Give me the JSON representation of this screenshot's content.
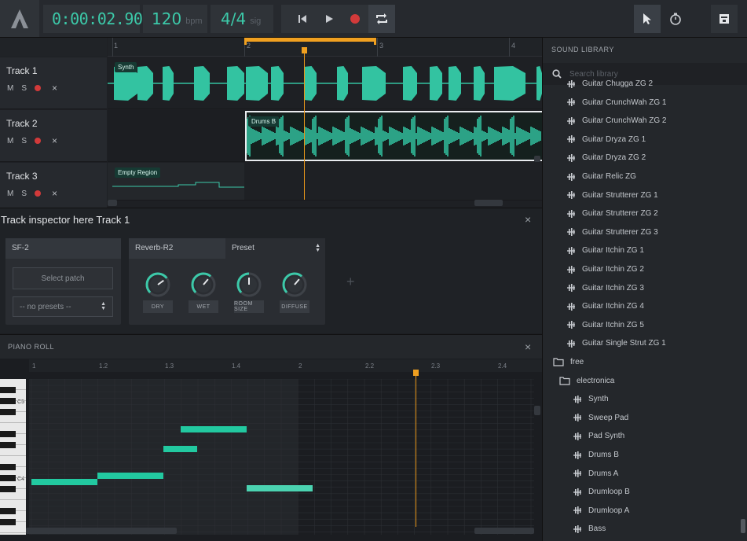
{
  "toolbar": {
    "time": "0:00:02.90",
    "bpm_value": "120",
    "bpm_unit": "bpm",
    "sig_value": "4/4",
    "sig_unit": "sig"
  },
  "arrangement": {
    "ruler_ticks": [
      "1",
      "2",
      "3",
      "4"
    ],
    "tracks": [
      {
        "name": "Track 1",
        "mute": "M",
        "solo": "S",
        "delete": "×",
        "region": "Synth"
      },
      {
        "name": "Track 2",
        "mute": "M",
        "solo": "S",
        "delete": "×",
        "region": "Drums B"
      },
      {
        "name": "Track 3",
        "mute": "M",
        "solo": "S",
        "delete": "×",
        "region": "Empty Region"
      }
    ]
  },
  "inspector": {
    "title": "Track inspector here Track 1",
    "close": "×",
    "instrument": {
      "name": "SF-2",
      "patch_button": "Select patch",
      "presets": "-- no presets --"
    },
    "effect": {
      "name": "Reverb-R2",
      "preset_label": "Preset",
      "knobs": [
        {
          "label": "DRY",
          "value": 0.7
        },
        {
          "label": "WET",
          "value": 0.65
        },
        {
          "label": "ROOM SIZE",
          "value": 0.5
        },
        {
          "label": "DIFFUSE",
          "value": 0.65
        }
      ]
    },
    "add": "+"
  },
  "piano_roll": {
    "title": "PIANO ROLL",
    "close": "×",
    "ruler_ticks": [
      "1",
      "1.2",
      "1.3",
      "1.4",
      "2",
      "2.2",
      "2.3",
      "2.4"
    ],
    "key_labels": [
      "C5",
      "C4"
    ]
  },
  "library": {
    "title": "SOUND LIBRARY",
    "search_placeholder": "Search library",
    "items": [
      {
        "label": "Guitar Chugga ZG 2",
        "kind": "sample",
        "indent": 1
      },
      {
        "label": "Guitar CrunchWah ZG 1",
        "kind": "sample",
        "indent": 1
      },
      {
        "label": "Guitar CrunchWah ZG 2",
        "kind": "sample",
        "indent": 1
      },
      {
        "label": "Guitar Dryza ZG 1",
        "kind": "sample",
        "indent": 1
      },
      {
        "label": "Guitar Dryza ZG 2",
        "kind": "sample",
        "indent": 1
      },
      {
        "label": "Guitar Relic ZG",
        "kind": "sample",
        "indent": 1
      },
      {
        "label": "Guitar Strutterer ZG 1",
        "kind": "sample",
        "indent": 1
      },
      {
        "label": "Guitar Strutterer ZG 2",
        "kind": "sample",
        "indent": 1
      },
      {
        "label": "Guitar Strutterer ZG 3",
        "kind": "sample",
        "indent": 1
      },
      {
        "label": "Guitar Itchin ZG 1",
        "kind": "sample",
        "indent": 1
      },
      {
        "label": "Guitar Itchin ZG 2",
        "kind": "sample",
        "indent": 1
      },
      {
        "label": "Guitar Itchin ZG 3",
        "kind": "sample",
        "indent": 1
      },
      {
        "label": "Guitar Itchin ZG 4",
        "kind": "sample",
        "indent": 1
      },
      {
        "label": "Guitar Itchin ZG 5",
        "kind": "sample",
        "indent": 1
      },
      {
        "label": "Guitar Single Strut ZG 1",
        "kind": "sample",
        "indent": 1
      },
      {
        "label": "free",
        "kind": "folder",
        "indent": 0
      },
      {
        "label": "electronica",
        "kind": "folder",
        "indent": 1
      },
      {
        "label": "Synth",
        "kind": "sample",
        "indent": 2
      },
      {
        "label": "Sweep Pad",
        "kind": "sample",
        "indent": 2
      },
      {
        "label": "Pad Synth",
        "kind": "sample",
        "indent": 2
      },
      {
        "label": "Drums B",
        "kind": "sample",
        "indent": 2
      },
      {
        "label": "Drums A",
        "kind": "sample",
        "indent": 2
      },
      {
        "label": "Drumloop B",
        "kind": "sample",
        "indent": 2
      },
      {
        "label": "Drumloop A",
        "kind": "sample",
        "indent": 2
      },
      {
        "label": "Bass",
        "kind": "sample",
        "indent": 2
      }
    ]
  },
  "colors": {
    "accent": "#3cc9a9",
    "playhead": "#f0a020",
    "record": "#d23a3a"
  }
}
